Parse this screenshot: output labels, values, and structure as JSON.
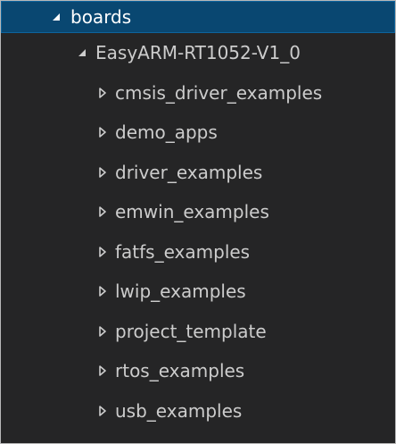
{
  "tree": {
    "root": {
      "label": "boards",
      "expanded": true
    },
    "board": {
      "label": "EasyARM-RT1052-V1_0",
      "expanded": true
    },
    "children": [
      {
        "label": "cmsis_driver_examples"
      },
      {
        "label": "demo_apps"
      },
      {
        "label": "driver_examples"
      },
      {
        "label": "emwin_examples"
      },
      {
        "label": "fatfs_examples"
      },
      {
        "label": "lwip_examples"
      },
      {
        "label": "project_template"
      },
      {
        "label": "rtos_examples"
      },
      {
        "label": "usb_examples"
      }
    ]
  },
  "icons": {
    "expanded": "expanded-triangle-icon",
    "collapsed": "collapsed-triangle-icon"
  },
  "colors": {
    "background": "#252526",
    "selection": "#094771",
    "text": "#cccccc"
  }
}
